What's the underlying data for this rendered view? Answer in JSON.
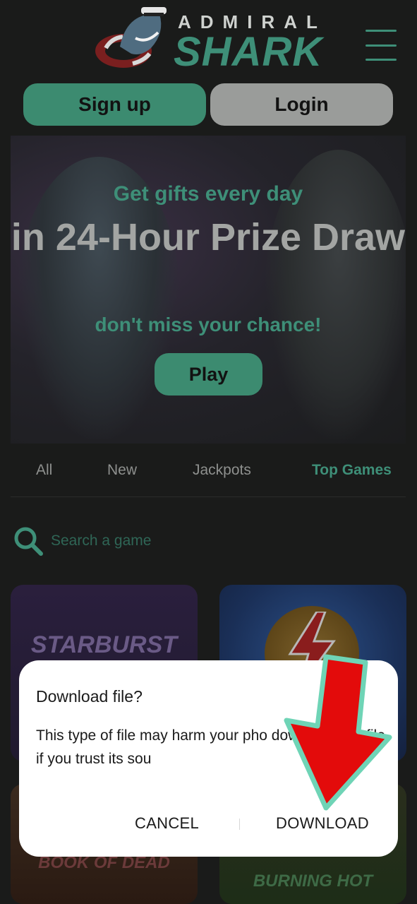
{
  "header": {
    "brand_top": "ADMIRAL",
    "brand_main": "SHARK",
    "logo_icon": "shark-mascot-icon",
    "menu_icon": "hamburger-menu-icon"
  },
  "auth": {
    "signup_label": "Sign up",
    "login_label": "Login"
  },
  "banner": {
    "line1": "Get gifts every day",
    "line2": "in 24-Hour Prize Draw",
    "line3": "don't miss your chance!",
    "play_label": "Play"
  },
  "tabs": [
    {
      "label": "All"
    },
    {
      "label": "New"
    },
    {
      "label": "Jackpots"
    },
    {
      "label": "Top Games",
      "active": true
    }
  ],
  "search": {
    "placeholder": "Search a game",
    "icon": "search-icon"
  },
  "games": [
    {
      "title": "STARBURST"
    },
    {
      "title": ""
    },
    {
      "title": "BOOK OF DEAD"
    },
    {
      "title": "BURNING HOT"
    }
  ],
  "dialog": {
    "title": "Download file?",
    "body": "This type of file may harm your pho download this file if you trust its sou",
    "cancel_label": "CANCEL",
    "download_label": "DOWNLOAD"
  },
  "colors": {
    "accent": "#3c8b70",
    "background": "#1a1b1a",
    "arrow": "#e30b0b",
    "arrow_outline": "#6fd4b6"
  }
}
